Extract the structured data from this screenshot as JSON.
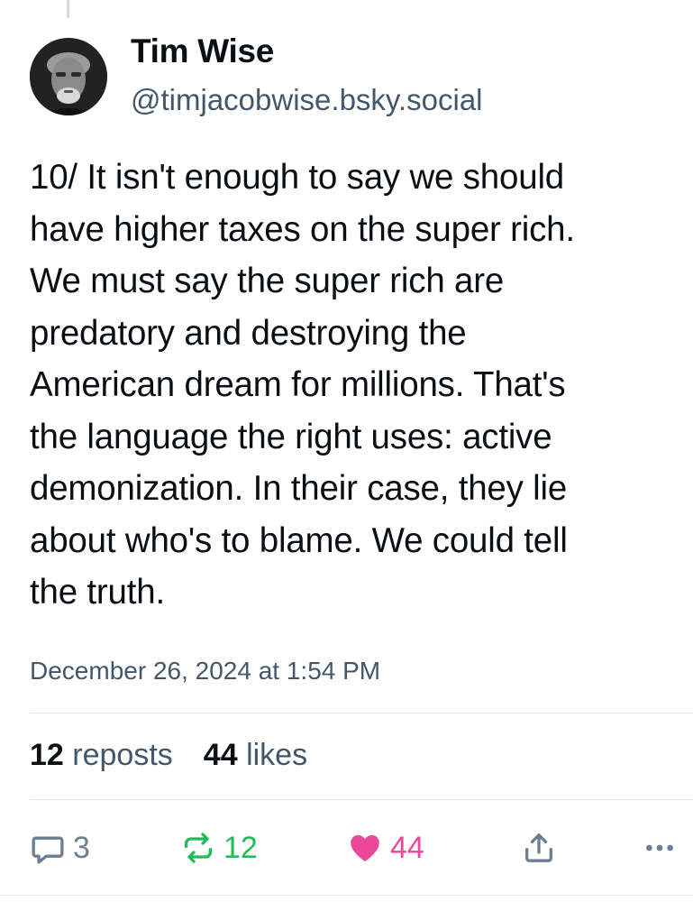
{
  "author": {
    "display_name": "Tim Wise",
    "handle": "@timjacobwise.bsky.social",
    "avatar_icon": "user-avatar-photo"
  },
  "post": {
    "text": "10/ It isn't enough to say we should\nhave higher taxes on the super rich.\nWe must say the super rich are\npredatory and destroying the\nAmerican dream for millions. That's\nthe language the right uses: active\ndemonization. In their case, they lie\nabout who's to blame. We could tell\nthe truth.",
    "timestamp": "December 26, 2024 at 1:54 PM"
  },
  "stats": {
    "reposts_count": "12",
    "reposts_label": "reposts",
    "likes_count": "44",
    "likes_label": "likes"
  },
  "actions": {
    "reply_count": "3",
    "repost_count": "12",
    "like_count": "44",
    "reply_icon": "reply-bubble-icon",
    "repost_icon": "repost-arrows-icon",
    "like_icon": "heart-icon",
    "share_icon": "share-icon",
    "more_icon": "more-dots-icon"
  },
  "colors": {
    "text_primary": "#0b0f14",
    "text_secondary": "#42576c",
    "repost_active": "#20bc57",
    "like_active": "#ec4899",
    "icon_muted": "#6b7f94",
    "divider": "#dfe4ea"
  }
}
